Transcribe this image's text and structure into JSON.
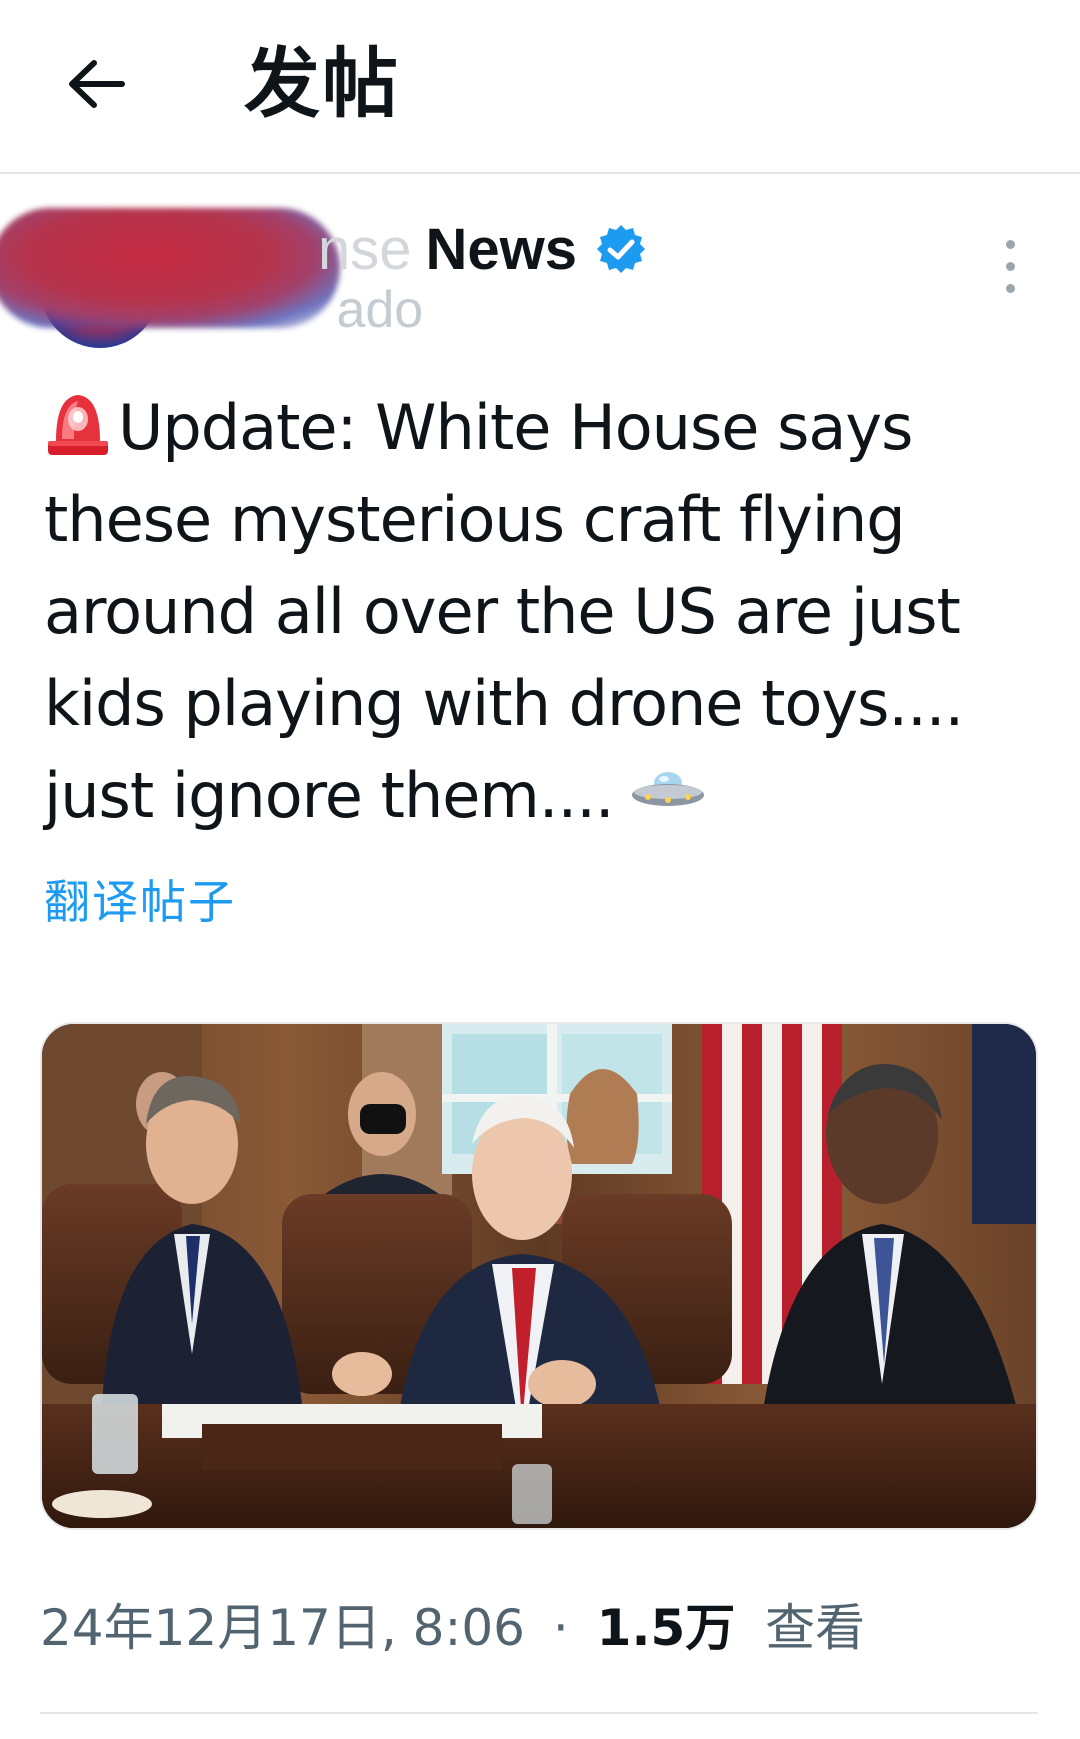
{
  "header": {
    "back_icon": "arrow-left-icon",
    "title": "发帖"
  },
  "author": {
    "name_visible_prefix": "nse",
    "name_visible": "News",
    "handle_visible_suffix": "ado",
    "verified_icon": "verified-badge-icon",
    "verified_color": "#1d9bf0",
    "more_icon": "more-vertical-icon"
  },
  "post": {
    "lines": [
      "Update: White House says",
      "these mysterious craft flying",
      "around all over the US are just",
      "kids playing with drone toys....",
      "just ignore them...."
    ],
    "leading_emoji": "rotating-light-icon",
    "trailing_emoji": "flying-saucer-icon",
    "translate_label": "翻译帖子"
  },
  "meta": {
    "datetime": "24年12月17日, 8:06",
    "separator": "·",
    "views_count": "1.5万",
    "views_label": "查看"
  },
  "colors": {
    "accent": "#1d9bf0",
    "text": "#0f1419",
    "muted": "#536471"
  }
}
